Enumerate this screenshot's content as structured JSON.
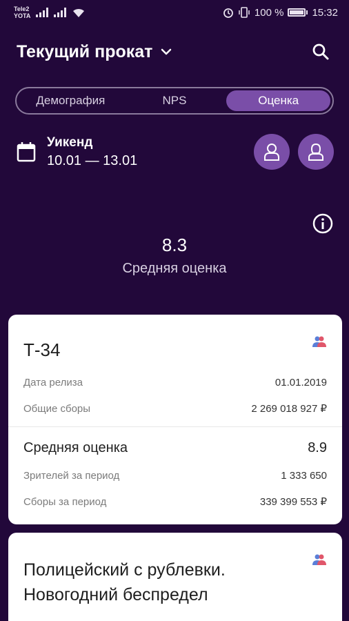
{
  "status_bar": {
    "carrier_top": "Tele2",
    "carrier_bottom": "YOTA",
    "battery_percent": "100 %",
    "time": "15:32"
  },
  "header": {
    "title": "Текущий прокат",
    "icons": {
      "dropdown": "chevron-down-icon",
      "search": "search-icon"
    }
  },
  "tabs": [
    {
      "label": "Демография",
      "active": false
    },
    {
      "label": "NPS",
      "active": false
    },
    {
      "label": "Оценка",
      "active": true
    }
  ],
  "period": {
    "label": "Уикенд",
    "dates": "10.01 — 13.01",
    "icon": "calendar-icon"
  },
  "summary": {
    "value": "8.3",
    "label": "Средняя оценка"
  },
  "colors": {
    "background": "#22083a",
    "accent": "#7a4ea8",
    "card": "#ffffff"
  },
  "films": [
    {
      "title": "Т-34",
      "release_label": "Дата релиза",
      "release_value": "01.01.2019",
      "gross_label": "Общие сборы",
      "gross_value": "2 269 018 927 ₽",
      "rating_label": "Средняя оценка",
      "rating_value": "8.9",
      "viewers_label": "Зрителей за период",
      "viewers_value": "1 333 650",
      "period_gross_label": "Сборы за период",
      "period_gross_value": "339 399 553 ₽"
    },
    {
      "title": "Полицейский с рублевки. Новогодний беспредел"
    }
  ]
}
